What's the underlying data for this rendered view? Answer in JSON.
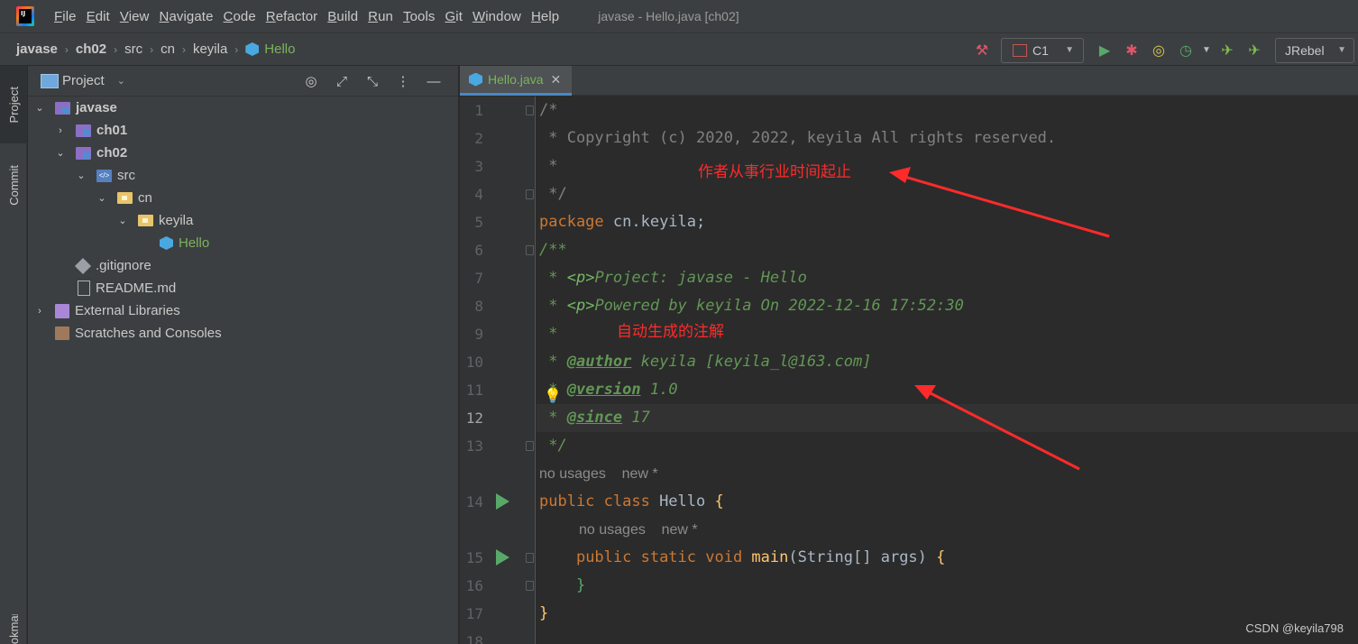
{
  "menu": {
    "items": [
      "File",
      "Edit",
      "View",
      "Navigate",
      "Code",
      "Refactor",
      "Build",
      "Run",
      "Tools",
      "Git",
      "Window",
      "Help"
    ],
    "window_title": "javase - Hello.java [ch02]"
  },
  "breadcrumb": [
    "javase",
    "ch02",
    "src",
    "cn",
    "keyila",
    "Hello"
  ],
  "toolbar": {
    "run_config": "C1",
    "jrebel": "JRebel"
  },
  "tool_strip": {
    "project": "Project",
    "commit": "Commit",
    "bookmarks": "Bookmarks"
  },
  "project_panel": {
    "title": "Project",
    "tree": [
      "javase",
      "ch01",
      "ch02",
      "src",
      "cn",
      "keyila",
      "Hello",
      ".gitignore",
      "README.md",
      "External Libraries",
      "Scratches and Consoles"
    ]
  },
  "editor": {
    "tab": "Hello.java",
    "line_numbers": [
      "1",
      "2",
      "3",
      "4",
      "5",
      "6",
      "7",
      "8",
      "9",
      "10",
      "11",
      "12",
      "13",
      "14",
      "15",
      "16",
      "17",
      "18"
    ],
    "current_line": "12",
    "code": {
      "l1": "/*",
      "l2": " * Copyright (c) 2020, 2022, keyila All rights reserved.",
      "l3": " *",
      "l4": " */",
      "l5_kw": "package",
      "l5_rest": " cn.keyila;",
      "l6": "/**",
      "l7_pre": " * ",
      "l7_tag": "<p>",
      "l7_rest": "Project: javase - Hello",
      "l8_pre": " * ",
      "l8_tag": "<p>",
      "l8_rest": "Powered by keyila On 2022-12-16 17:52:30",
      "l9": " *",
      "l10_pre": " * ",
      "l10_tag": "@author",
      "l10_rest": " keyila [keyila_l@163.com]",
      "l11_pre": " * ",
      "l11_tag": "@version",
      "l11_rest": " 1.0",
      "l12_pre": " * ",
      "l12_tag": "@since",
      "l12_rest": " 17",
      "l13": " */",
      "l14_kw": "public class",
      "l14_name": " Hello ",
      "l14_brace": "{",
      "l15_indent": "    ",
      "l15_kw": "public static void",
      "l15_method": " main",
      "l15_rest": "(String[] args) ",
      "l15_brace": "{",
      "l16": "    }",
      "l17": "}"
    },
    "hints": {
      "class_hint": "no usages    new *",
      "method_hint": "no usages    new *"
    }
  },
  "annotations": {
    "years_note": "作者从事行业时间起止",
    "auto_note": "自动生成的注解"
  },
  "watermark": "CSDN @keyila798"
}
